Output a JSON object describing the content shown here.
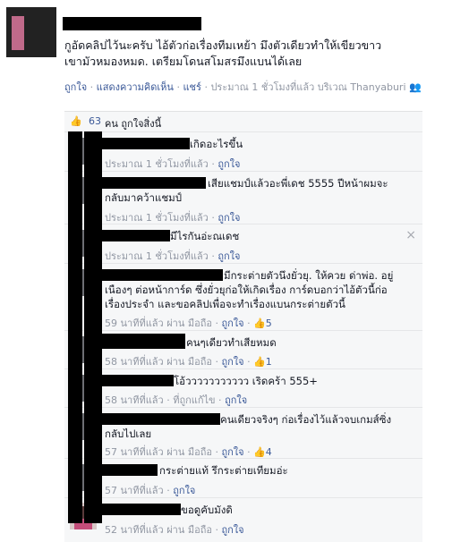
{
  "post": {
    "text_line1": "กูอัดคลิปไว้นะครับ  ไอ้ตัวก่อเรื่องทีมเหย้า  มึงตัวเดียวทำให้เขียวขาว",
    "text_line2": "เขามัวหมองหมด.  เตรียมโดนสโมสรมึงแบนได้เลย",
    "actions": {
      "like": "ถูกใจ",
      "comment": "แสดงความคิดเห็น",
      "share": "แชร์",
      "time": "ประมาณ 1 ชั่วโมงที่แล้ว บริเวณ Thanyaburi"
    }
  },
  "likes_bar": {
    "count": "63",
    "label": "คน ถูกใจสิ่งนี้"
  },
  "comments": [
    {
      "text": "เกิดอะไรขึ้น",
      "meta": "ประมาณ 1 ชั่วโมงที่แล้ว · ",
      "like": "ถูกใจ"
    },
    {
      "text": "เสียแชมป์แล้วอะพี่เดช 5555 ปีหน้าผมจะ",
      "text2": "กลับมาคว้าแชมป์",
      "meta": "ประมาณ 1 ชั่วโมงที่แล้ว · ",
      "like": "ถูกใจ"
    },
    {
      "text": "มีไรกันอ่ะณเดช",
      "meta": "ประมาณ 1 ชั่วโมงที่แล้ว · ",
      "like": "ถูกใจ",
      "close": "×"
    },
    {
      "text": "มีกระต่ายตัวนึงยั่วยุ. ให้ควย ด่าพ่อ. อยู่",
      "text2": "เนืองๆ ต่อหน้าการ์ด ซึ่งยั่วยุก่อให้เกิดเรื่อง การ์ดบอกว่าไอ้ตัวนี้ก่อ",
      "text3": "เรื่องประจำ และขอคลิปเพื่อจะทำเรื่องแบนกระต่ายตัวนี้",
      "meta": "59 นาทีที่แล้ว ผ่าน มือถือ · ",
      "like": "ถูกใจ",
      "likes": "5"
    },
    {
      "text": "คนๆเดียวทำเสียหมด",
      "meta": "58 นาทีที่แล้ว ผ่าน มือถือ · ",
      "like": "ถูกใจ",
      "likes": "1"
    },
    {
      "text": "โอ้ววววววววววว เริดคร้า 555+",
      "meta": "58 นาทีที่แล้ว · ที่ถูกแก้ไข · ",
      "like": "ถูกใจ"
    },
    {
      "text": "คนเดียวจริงๆ ก่อเรื่องไว้แล้วจบเกมส์ซิ่ง",
      "text2": "กลับไปเลย",
      "meta": "57 นาทีที่แล้ว ผ่าน มือถือ · ",
      "like": "ถูกใจ",
      "likes": "4"
    },
    {
      "text": "กระต่ายแท้ รึกระต่ายเทียมอ่ะ",
      "meta": "57 นาทีที่แล้ว · ",
      "like": "ถูกใจ"
    },
    {
      "text": "ขอดูคับมังดิ",
      "meta": "52 นาทีที่แล้ว ผ่าน มือถือ · ",
      "like": "ถูกใจ"
    }
  ],
  "icons": {
    "like": "thumbs-up-icon",
    "friends": "friends-icon",
    "close": "close-icon"
  },
  "colors": {
    "link": "#3b5998",
    "meta": "#9197a3",
    "comment_bg": "#f6f7f8"
  }
}
